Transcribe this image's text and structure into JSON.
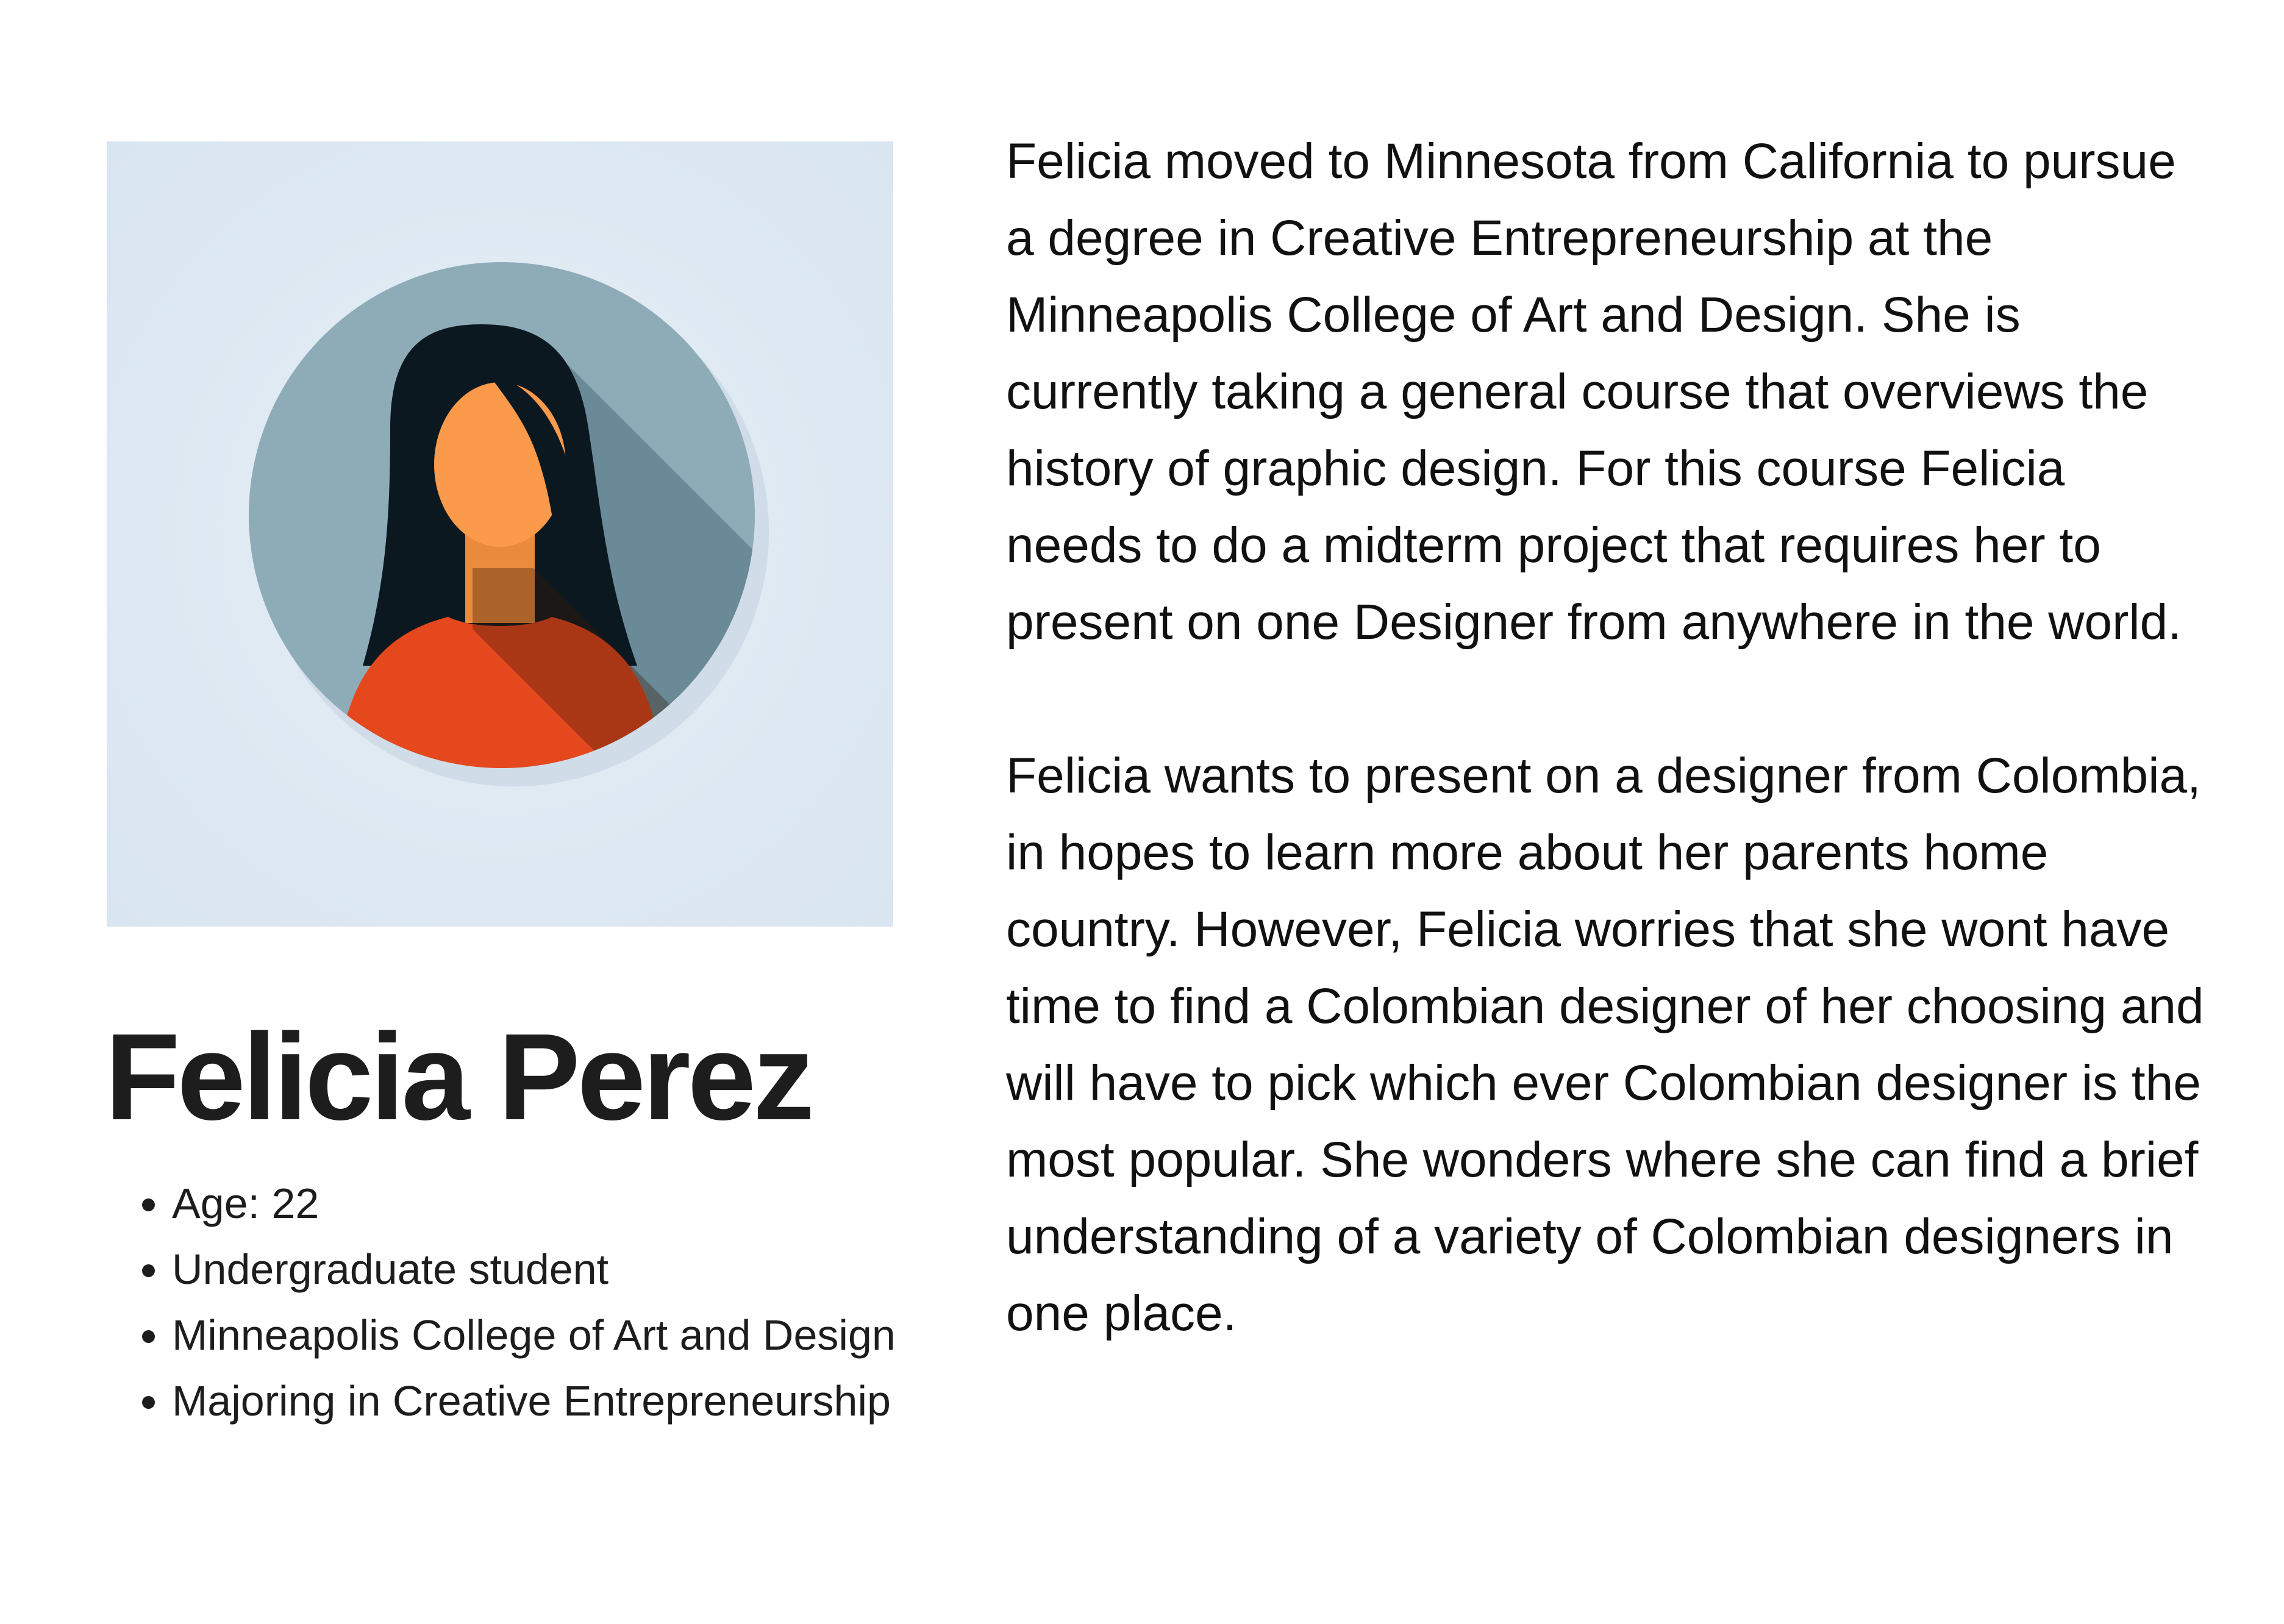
{
  "persona": {
    "name": "Felicia Perez",
    "avatar_icon": "woman-avatar-icon",
    "facts": [
      "Age: 22",
      "Undergraduate student",
      "Minneapolis College of Art and Design",
      "Majoring in Creative Entrepreneurship"
    ]
  },
  "bio": {
    "paragraphs": [
      "Felicia moved to Minnesota from California to pursue a degree in Creative Entrepreneurship at the Minneapolis College of Art and Design. She is currently taking a general course that overviews the history of graphic design. For this course Felicia needs to do a midterm project that requires her to present on one Designer from anywhere in the world.",
      "Felicia wants to present on a designer from Colombia, in hopes to learn more about her parents home country. However, Felicia worries that she wont have time to find a Colombian designer of her choosing and will have to pick which ever Colombian designer is the most popular. She wonders where she can find a brief understanding of a variety of Colombian designers in one place."
    ]
  },
  "colors": {
    "background": "#ffffff",
    "avatar_panel": "#dde8f2",
    "avatar_circle": "#8eacb8",
    "hair": "#0b1820",
    "skin": "#fa9a4a",
    "shirt": "#e5481d",
    "text": "#111111"
  }
}
